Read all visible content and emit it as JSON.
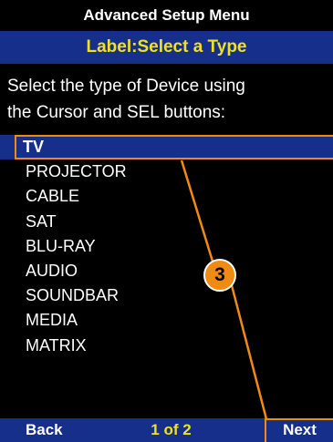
{
  "header": {
    "title": "Advanced Setup Menu",
    "subtitle": "Label:Select a Type"
  },
  "instructions": {
    "line1": "Select the type of Device using",
    "line2": "the Cursor and SEL buttons:"
  },
  "device_types": [
    {
      "label": "TV",
      "selected": true
    },
    {
      "label": "PROJECTOR",
      "selected": false
    },
    {
      "label": "CABLE",
      "selected": false
    },
    {
      "label": "SAT",
      "selected": false
    },
    {
      "label": "BLU-RAY",
      "selected": false
    },
    {
      "label": "AUDIO",
      "selected": false
    },
    {
      "label": "SOUNDBAR",
      "selected": false
    },
    {
      "label": "MEDIA",
      "selected": false
    },
    {
      "label": "MATRIX",
      "selected": false
    }
  ],
  "footer": {
    "back_label": "Back",
    "page_indicator": "1 of 2",
    "next_label": "Next"
  },
  "callout": {
    "number": "3",
    "color": "#f08a13"
  },
  "colors": {
    "background": "#000000",
    "highlight_bar": "#152f8a",
    "accent_text": "#f1e11f",
    "text": "#ffffff"
  }
}
